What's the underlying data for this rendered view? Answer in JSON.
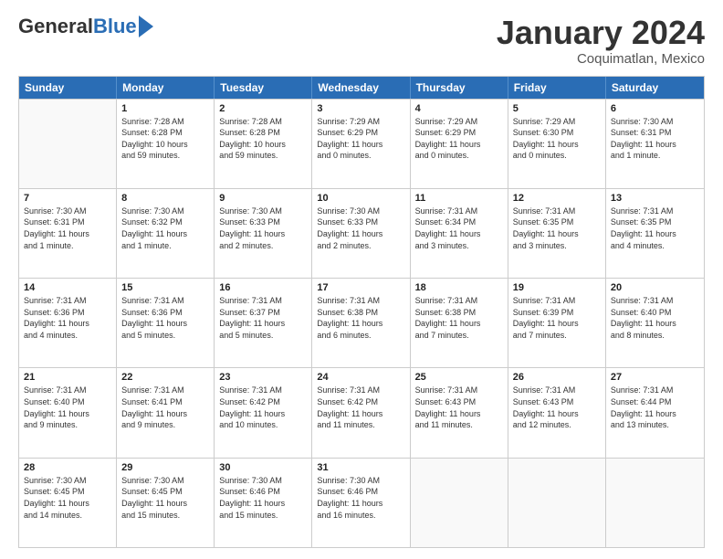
{
  "logo": {
    "general": "General",
    "blue": "Blue"
  },
  "title": "January 2024",
  "location": "Coquimatlan, Mexico",
  "headers": [
    "Sunday",
    "Monday",
    "Tuesday",
    "Wednesday",
    "Thursday",
    "Friday",
    "Saturday"
  ],
  "weeks": [
    [
      {
        "day": "",
        "info": ""
      },
      {
        "day": "1",
        "info": "Sunrise: 7:28 AM\nSunset: 6:28 PM\nDaylight: 10 hours\nand 59 minutes."
      },
      {
        "day": "2",
        "info": "Sunrise: 7:28 AM\nSunset: 6:28 PM\nDaylight: 10 hours\nand 59 minutes."
      },
      {
        "day": "3",
        "info": "Sunrise: 7:29 AM\nSunset: 6:29 PM\nDaylight: 11 hours\nand 0 minutes."
      },
      {
        "day": "4",
        "info": "Sunrise: 7:29 AM\nSunset: 6:29 PM\nDaylight: 11 hours\nand 0 minutes."
      },
      {
        "day": "5",
        "info": "Sunrise: 7:29 AM\nSunset: 6:30 PM\nDaylight: 11 hours\nand 0 minutes."
      },
      {
        "day": "6",
        "info": "Sunrise: 7:30 AM\nSunset: 6:31 PM\nDaylight: 11 hours\nand 1 minute."
      }
    ],
    [
      {
        "day": "7",
        "info": "Sunrise: 7:30 AM\nSunset: 6:31 PM\nDaylight: 11 hours\nand 1 minute."
      },
      {
        "day": "8",
        "info": "Sunrise: 7:30 AM\nSunset: 6:32 PM\nDaylight: 11 hours\nand 1 minute."
      },
      {
        "day": "9",
        "info": "Sunrise: 7:30 AM\nSunset: 6:33 PM\nDaylight: 11 hours\nand 2 minutes."
      },
      {
        "day": "10",
        "info": "Sunrise: 7:30 AM\nSunset: 6:33 PM\nDaylight: 11 hours\nand 2 minutes."
      },
      {
        "day": "11",
        "info": "Sunrise: 7:31 AM\nSunset: 6:34 PM\nDaylight: 11 hours\nand 3 minutes."
      },
      {
        "day": "12",
        "info": "Sunrise: 7:31 AM\nSunset: 6:35 PM\nDaylight: 11 hours\nand 3 minutes."
      },
      {
        "day": "13",
        "info": "Sunrise: 7:31 AM\nSunset: 6:35 PM\nDaylight: 11 hours\nand 4 minutes."
      }
    ],
    [
      {
        "day": "14",
        "info": "Sunrise: 7:31 AM\nSunset: 6:36 PM\nDaylight: 11 hours\nand 4 minutes."
      },
      {
        "day": "15",
        "info": "Sunrise: 7:31 AM\nSunset: 6:36 PM\nDaylight: 11 hours\nand 5 minutes."
      },
      {
        "day": "16",
        "info": "Sunrise: 7:31 AM\nSunset: 6:37 PM\nDaylight: 11 hours\nand 5 minutes."
      },
      {
        "day": "17",
        "info": "Sunrise: 7:31 AM\nSunset: 6:38 PM\nDaylight: 11 hours\nand 6 minutes."
      },
      {
        "day": "18",
        "info": "Sunrise: 7:31 AM\nSunset: 6:38 PM\nDaylight: 11 hours\nand 7 minutes."
      },
      {
        "day": "19",
        "info": "Sunrise: 7:31 AM\nSunset: 6:39 PM\nDaylight: 11 hours\nand 7 minutes."
      },
      {
        "day": "20",
        "info": "Sunrise: 7:31 AM\nSunset: 6:40 PM\nDaylight: 11 hours\nand 8 minutes."
      }
    ],
    [
      {
        "day": "21",
        "info": "Sunrise: 7:31 AM\nSunset: 6:40 PM\nDaylight: 11 hours\nand 9 minutes."
      },
      {
        "day": "22",
        "info": "Sunrise: 7:31 AM\nSunset: 6:41 PM\nDaylight: 11 hours\nand 9 minutes."
      },
      {
        "day": "23",
        "info": "Sunrise: 7:31 AM\nSunset: 6:42 PM\nDaylight: 11 hours\nand 10 minutes."
      },
      {
        "day": "24",
        "info": "Sunrise: 7:31 AM\nSunset: 6:42 PM\nDaylight: 11 hours\nand 11 minutes."
      },
      {
        "day": "25",
        "info": "Sunrise: 7:31 AM\nSunset: 6:43 PM\nDaylight: 11 hours\nand 11 minutes."
      },
      {
        "day": "26",
        "info": "Sunrise: 7:31 AM\nSunset: 6:43 PM\nDaylight: 11 hours\nand 12 minutes."
      },
      {
        "day": "27",
        "info": "Sunrise: 7:31 AM\nSunset: 6:44 PM\nDaylight: 11 hours\nand 13 minutes."
      }
    ],
    [
      {
        "day": "28",
        "info": "Sunrise: 7:30 AM\nSunset: 6:45 PM\nDaylight: 11 hours\nand 14 minutes."
      },
      {
        "day": "29",
        "info": "Sunrise: 7:30 AM\nSunset: 6:45 PM\nDaylight: 11 hours\nand 15 minutes."
      },
      {
        "day": "30",
        "info": "Sunrise: 7:30 AM\nSunset: 6:46 PM\nDaylight: 11 hours\nand 15 minutes."
      },
      {
        "day": "31",
        "info": "Sunrise: 7:30 AM\nSunset: 6:46 PM\nDaylight: 11 hours\nand 16 minutes."
      },
      {
        "day": "",
        "info": ""
      },
      {
        "day": "",
        "info": ""
      },
      {
        "day": "",
        "info": ""
      }
    ]
  ]
}
